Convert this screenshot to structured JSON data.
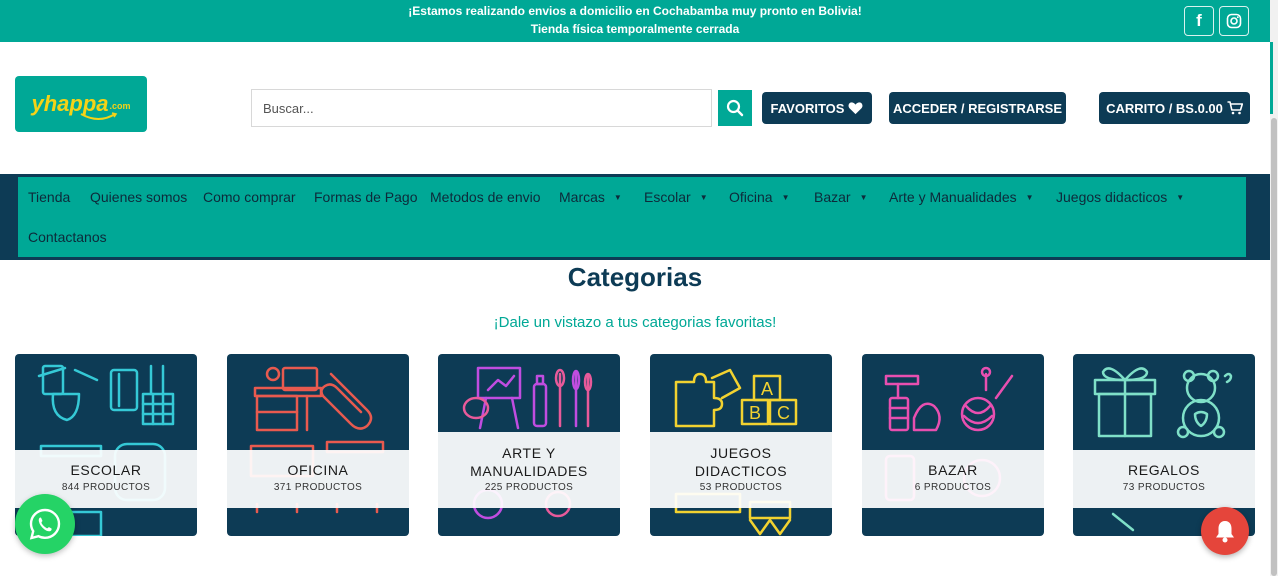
{
  "topbar": {
    "message_line1": "¡Estamos realizando envios a domicilio en Cochabamba muy pronto en Bolivia!",
    "message_line2": "Tienda física temporalmente cerrada",
    "social_icons": [
      "facebook-icon",
      "instagram-icon"
    ]
  },
  "header": {
    "logo": {
      "text": "yhappa",
      "suffix": ".com",
      "colors": {
        "background": "#00a896",
        "text": "#f5d317"
      }
    },
    "search": {
      "placeholder": "Buscar...",
      "value": ""
    },
    "favorites_label": "FAVORITOS",
    "login_label": "ACCEDER / REGISTRARSE",
    "cart_label": "CARRITO / BS.0.00"
  },
  "nav": {
    "items": [
      {
        "label": "Tienda",
        "dropdown": false
      },
      {
        "label": "Quienes somos",
        "dropdown": false
      },
      {
        "label": "Como comprar",
        "dropdown": false
      },
      {
        "label": "Formas de Pago",
        "dropdown": false
      },
      {
        "label": "Metodos de envio",
        "dropdown": false
      },
      {
        "label": "Marcas",
        "dropdown": true
      },
      {
        "label": "Escolar",
        "dropdown": true
      },
      {
        "label": "Oficina",
        "dropdown": true
      },
      {
        "label": "Bazar",
        "dropdown": true
      },
      {
        "label": "Arte y Manualidades",
        "dropdown": true
      },
      {
        "label": "Juegos didacticos",
        "dropdown": true
      },
      {
        "label": "Contactanos",
        "dropdown": false
      }
    ]
  },
  "categories": {
    "title": "Categorias",
    "subtitle": "¡Dale un vistazo a tus categorias favoritas!",
    "cards": [
      {
        "name": "ESCOLAR",
        "count": "844 PRODUCTOS"
      },
      {
        "name": "OFICINA",
        "count": "371 PRODUCTOS"
      },
      {
        "name_line1": "ARTE Y",
        "name_line2": "MANUALIDADES",
        "count": "225 PRODUCTOS"
      },
      {
        "name_line1": "JUEGOS",
        "name_line2": "DIDACTICOS",
        "count": "53 PRODUCTOS"
      },
      {
        "name": "BAZAR",
        "count": "6 PRODUCTOS"
      },
      {
        "name": "REGALOS",
        "count": "73 PRODUCTOS"
      }
    ]
  },
  "floating": {
    "whatsapp_icon": "whatsapp-icon",
    "notification_icon": "bell-icon"
  },
  "colors": {
    "teal": "#00a896",
    "navy": "#0d3b55",
    "bell_red": "#e5453b",
    "whatsapp_green": "#25d366"
  }
}
